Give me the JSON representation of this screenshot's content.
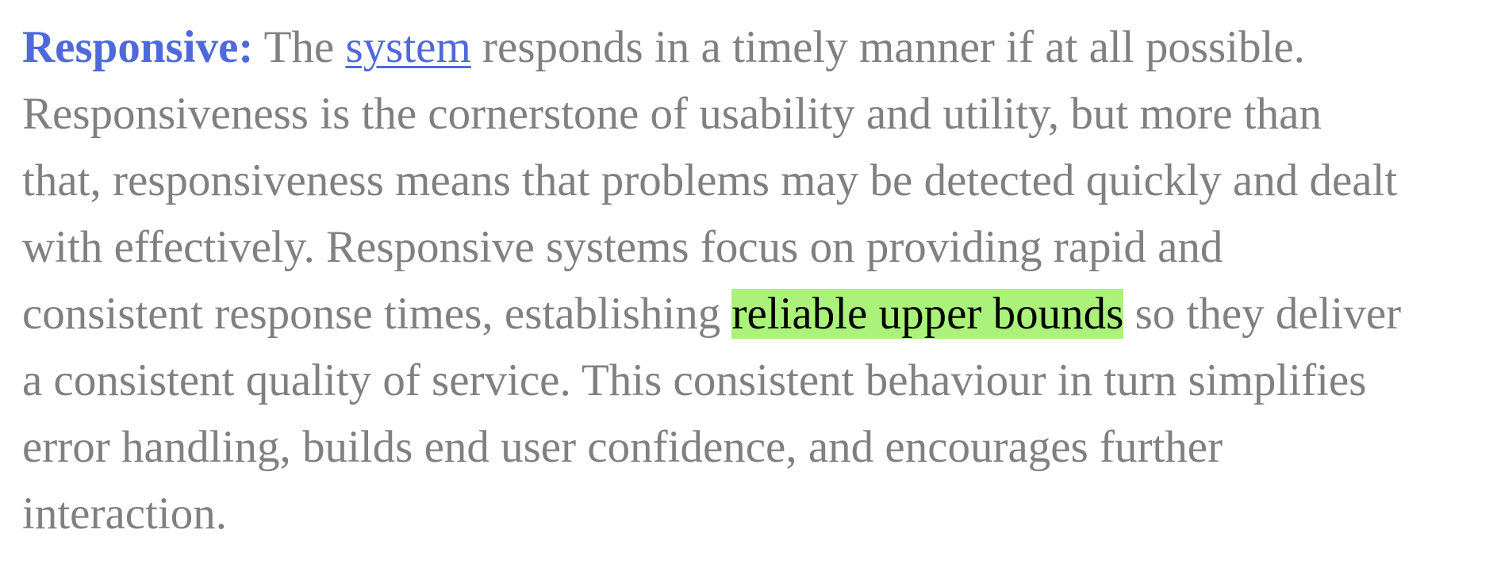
{
  "paragraph": {
    "term": "Responsive:",
    "text_1": " The ",
    "link_text": "system",
    "text_2": " responds in a timely manner if at all possible.",
    "line_2": "Responsiveness is the cornerstone of usability and utility, but more than",
    "line_3": "that, responsiveness means that problems may be detected quickly and dealt",
    "line_4": "with effectively. Responsive systems focus on providing rapid and",
    "line_5_start": "consistent response times, establishing ",
    "highlight": "reliable upper bounds",
    "line_5_end": " so they deliver",
    "line_6": "a consistent quality of service. This consistent behaviour in turn simplifies",
    "line_7": "error handling, builds end user confidence, and encourages further",
    "line_8": "interaction."
  },
  "colors": {
    "term": "#4f69dc",
    "link": "#4f69dc",
    "body_text": "#808080",
    "highlight_bg": "#abf27a",
    "highlight_text": "#000000"
  }
}
